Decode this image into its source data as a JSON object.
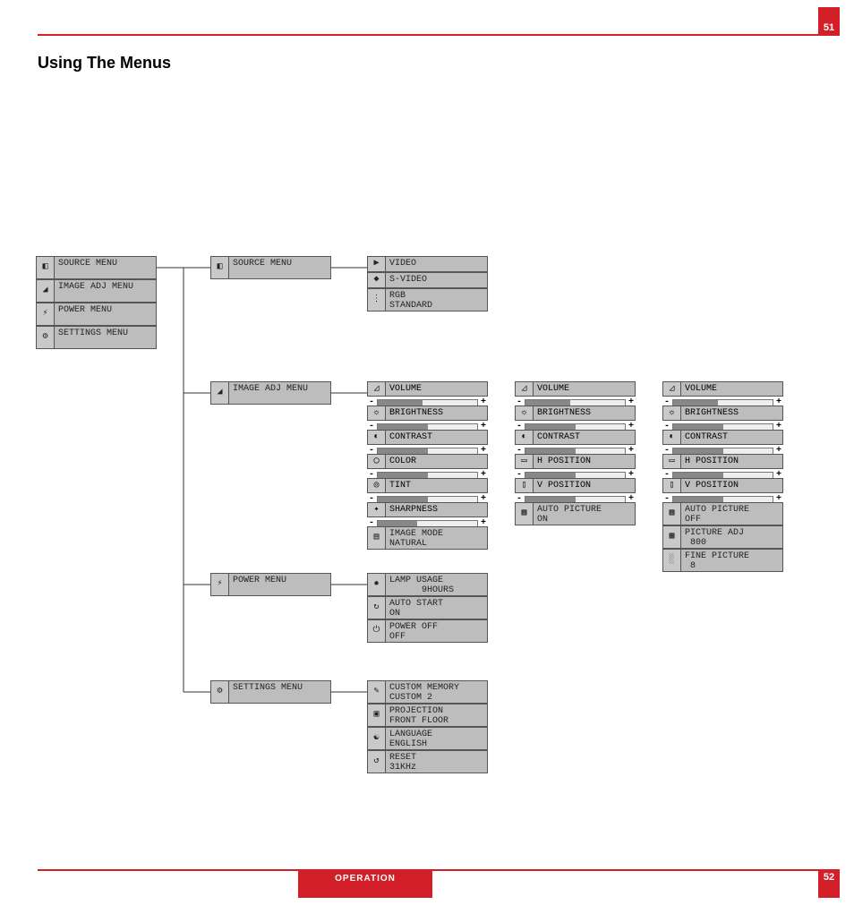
{
  "page": {
    "title": "Using The Menus",
    "top_number": "51",
    "bottom_number": "52",
    "section_label": "OPERATION"
  },
  "root_menu": [
    {
      "label": "SOURCE MENU",
      "icon": "source-icon"
    },
    {
      "label": "IMAGE ADJ MENU",
      "icon": "image-icon"
    },
    {
      "label": "POWER MENU",
      "icon": "power-icon"
    },
    {
      "label": "SETTINGS MENU",
      "icon": "settings-icon"
    }
  ],
  "headers": {
    "source": {
      "label": "SOURCE MENU",
      "icon": "source-icon"
    },
    "image": {
      "label": "IMAGE ADJ MENU",
      "icon": "image-icon"
    },
    "power": {
      "label": "POWER MENU",
      "icon": "power-icon"
    },
    "settings": {
      "label": "SETTINGS MENU",
      "icon": "settings-icon"
    }
  },
  "source_options": [
    {
      "label": "VIDEO",
      "icon": "video-icon"
    },
    {
      "label": "S-VIDEO",
      "icon": "svideo-icon"
    },
    {
      "label": "RGB\nSTANDARD",
      "icon": "rgb-icon"
    }
  ],
  "image_panels": {
    "a": {
      "sliders": [
        {
          "label": "VOLUME",
          "icon": "volume-icon",
          "fill": 0.45
        },
        {
          "label": "BRIGHTNESS",
          "icon": "bright-icon",
          "fill": 0.5
        },
        {
          "label": "CONTRAST",
          "icon": "contrast-icon",
          "fill": 0.5
        },
        {
          "label": "COLOR",
          "icon": "color-icon",
          "fill": 0.5
        },
        {
          "label": "TINT",
          "icon": "tint-icon",
          "fill": 0.5
        },
        {
          "label": "SHARPNESS",
          "icon": "sharp-icon",
          "fill": 0.4
        }
      ],
      "mode": {
        "label": "IMAGE MODE\nNATURAL",
        "icon": "mode-icon"
      }
    },
    "b": {
      "sliders": [
        {
          "label": "VOLUME",
          "icon": "volume-icon",
          "fill": 0.45
        },
        {
          "label": "BRIGHTNESS",
          "icon": "bright-icon",
          "fill": 0.5
        },
        {
          "label": "CONTRAST",
          "icon": "contrast-icon",
          "fill": 0.5
        },
        {
          "label": "H POSITION",
          "icon": "hpos-icon",
          "fill": 0.5
        },
        {
          "label": "V POSITION",
          "icon": "vpos-icon",
          "fill": 0.5
        }
      ],
      "auto": {
        "label": "AUTO PICTURE\nON",
        "icon": "auto-icon"
      }
    },
    "c": {
      "sliders": [
        {
          "label": "VOLUME",
          "icon": "volume-icon",
          "fill": 0.45
        },
        {
          "label": "BRIGHTNESS",
          "icon": "bright-icon",
          "fill": 0.5
        },
        {
          "label": "CONTRAST",
          "icon": "contrast-icon",
          "fill": 0.5
        },
        {
          "label": "H POSITION",
          "icon": "hpos-icon",
          "fill": 0.5
        },
        {
          "label": "V POSITION",
          "icon": "vpos-icon",
          "fill": 0.5
        }
      ],
      "extras": [
        {
          "label": "AUTO PICTURE\nOFF",
          "icon": "auto-icon"
        },
        {
          "label": "PICTURE ADJ\n 800",
          "icon": "padj-icon"
        },
        {
          "label": "FINE PICTURE\n 8",
          "icon": "fine-icon"
        }
      ]
    }
  },
  "power_options": [
    {
      "label": "LAMP USAGE\n      9HOURS",
      "icon": "lamp-icon"
    },
    {
      "label": "AUTO START\nON",
      "icon": "astart-icon"
    },
    {
      "label": "POWER OFF\nOFF",
      "icon": "poff-icon"
    }
  ],
  "settings_options": [
    {
      "label": "CUSTOM MEMORY\nCUSTOM 2",
      "icon": "mem-icon"
    },
    {
      "label": "PROJECTION\nFRONT FLOOR",
      "icon": "proj-icon"
    },
    {
      "label": "LANGUAGE\nENGLISH",
      "icon": "lang-icon"
    },
    {
      "label": "RESET\n31KHz",
      "icon": "reset-icon"
    }
  ],
  "symbols": {
    "minus": "-",
    "plus": "+"
  }
}
